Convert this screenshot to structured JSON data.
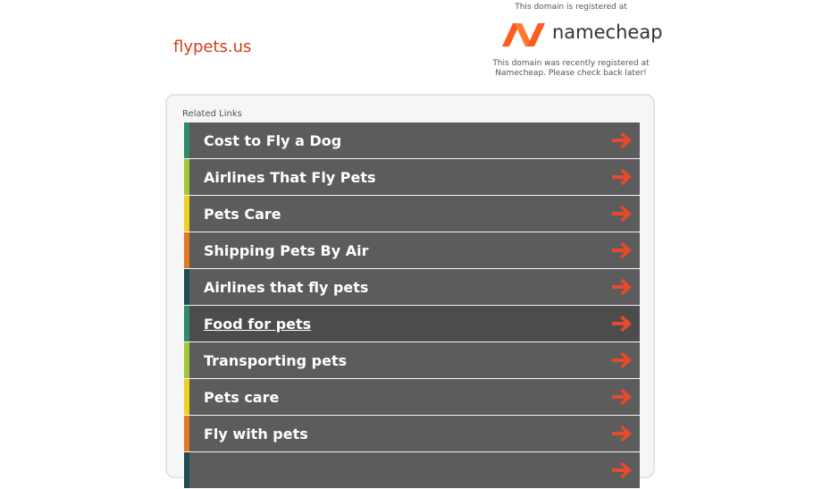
{
  "header": {
    "domain": "flypets.us"
  },
  "registrar": {
    "top_text": "This domain is registered at",
    "brand": "namecheap",
    "bottom_text_line1": "This domain was recently registered at",
    "bottom_text_line2": "Namecheap. Please check back later!",
    "brand_color": "#ff5a1f"
  },
  "related": {
    "label": "Related Links",
    "items": [
      {
        "label": "Cost to Fly a Dog",
        "stripe": "#2e8b6b"
      },
      {
        "label": "Airlines That Fly Pets",
        "stripe": "#a4c639"
      },
      {
        "label": "Pets Care",
        "stripe": "#f0d020"
      },
      {
        "label": "Shipping Pets By Air",
        "stripe": "#e87722"
      },
      {
        "label": "Airlines that fly pets",
        "stripe": "#1d4d52"
      },
      {
        "label": "Food for pets",
        "stripe": "#2e8b6b"
      },
      {
        "label": "Transporting pets",
        "stripe": "#a4c639"
      },
      {
        "label": "Pets care",
        "stripe": "#f0d020"
      },
      {
        "label": "Fly with pets",
        "stripe": "#e87722"
      },
      {
        "label": "",
        "stripe": "#1d4d52"
      }
    ],
    "arrow_color": "#e8492a"
  }
}
